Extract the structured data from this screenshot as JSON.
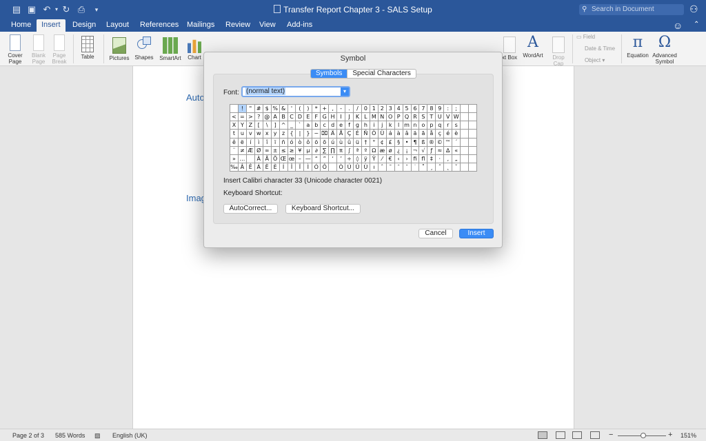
{
  "titlebar": {
    "document_title": "Transfer Report Chapter 3 - SALS Setup",
    "search_placeholder": "Search in Document",
    "icons": [
      "sidebar-icon",
      "save-icon",
      "undo-icon",
      "redo-icon",
      "print-icon",
      "customize-icon",
      "search-icon",
      "share-icon"
    ]
  },
  "ribbon_tabs": {
    "home": "Home",
    "insert": "Insert",
    "design": "Design",
    "layout": "Layout",
    "references": "References",
    "mailings": "Mailings",
    "review": "Review",
    "view": "View",
    "addins": "Add-ins",
    "active": "Insert"
  },
  "ribbon": {
    "cover_page": "Cover",
    "cover_page2": "Page",
    "blank_page": "Blank",
    "blank_page2": "Page",
    "page_break": "Page",
    "page_break2": "Break",
    "table": "Table",
    "pictures": "Pictures",
    "shapes": "Shapes",
    "smartart": "SmartArt",
    "chart": "Chart",
    "text_box": "xt Box",
    "wordart": "WordArt",
    "drop_cap": "Drop",
    "drop_cap2": "Cap",
    "field": "Field",
    "date_time": "Date & Time",
    "object": "Object",
    "equation": "Equation",
    "advanced_symbol": "Advanced",
    "advanced_symbol2": "Symbol",
    "equation_glyph": "π",
    "symbol_glyph": "Ω",
    "wordart_glyph": "A"
  },
  "document": {
    "heading_1": "Auto",
    "heading_2": "Imag"
  },
  "statusbar": {
    "page": "Page 2 of 3",
    "words": "585 Words",
    "language": "English (UK)",
    "zoom": "151%",
    "zoom_out": "−",
    "zoom_in": "+"
  },
  "dialog": {
    "title": "Symbol",
    "tabs": [
      "Symbols",
      "Special Characters"
    ],
    "active_tab": "Symbols",
    "font_label": "Font:",
    "font_value": "(normal text)",
    "selected_symbol": "!",
    "char_info": "Insert Calibri character 33  (Unicode character 0021)",
    "keyboard_shortcut_label": "Keyboard Shortcut:",
    "autocorrect_button": "AutoCorrect...",
    "keyboard_shortcut_button": "Keyboard Shortcut...",
    "cancel_button": "Cancel",
    "insert_button": "Insert",
    "symbol_rows": [
      [
        " ",
        "!",
        "\"",
        "#",
        "$",
        "%",
        "&",
        "'",
        "(",
        ")",
        "*",
        "+",
        ",",
        "-",
        ".",
        "/",
        "0",
        "1",
        "2",
        "3",
        "4",
        "5",
        "6",
        "7",
        "8",
        "9",
        ":",
        ";"
      ],
      [
        "<",
        "=",
        ">",
        "?",
        "@",
        "A",
        "B",
        "C",
        "D",
        "E",
        "F",
        "G",
        "H",
        "I",
        "J",
        "K",
        "L",
        "M",
        "N",
        "O",
        "P",
        "Q",
        "R",
        "S",
        "T",
        "U",
        "V",
        "W"
      ],
      [
        "X",
        "Y",
        "Z",
        "[",
        "\\",
        "]",
        "^",
        "_",
        "`",
        "a",
        "b",
        "c",
        "d",
        "e",
        "f",
        "g",
        "h",
        "i",
        "j",
        "k",
        "l",
        "m",
        "n",
        "o",
        "p",
        "q",
        "r",
        "s"
      ],
      [
        "t",
        "u",
        "v",
        "w",
        "x",
        "y",
        "z",
        "{",
        "|",
        "}",
        "~",
        "⌧",
        "Ä",
        "Å",
        "Ç",
        "É",
        "Ñ",
        "Ö",
        "Ü",
        "á",
        "à",
        "â",
        "ä",
        "ã",
        "å",
        "ç",
        "é",
        "è"
      ],
      [
        "ê",
        "ë",
        "í",
        "ì",
        "î",
        "ï",
        "ñ",
        "ó",
        "ò",
        "ô",
        "ö",
        "õ",
        "ú",
        "ù",
        "û",
        "ü",
        "†",
        "°",
        "¢",
        "£",
        "§",
        "•",
        "¶",
        "ß",
        "®",
        "©",
        "™",
        "´"
      ],
      [
        "¨",
        "≠",
        "Æ",
        "Ø",
        "∞",
        "±",
        "≤",
        "≥",
        "¥",
        "µ",
        "∂",
        "∑",
        "∏",
        "π",
        "∫",
        "ª",
        "º",
        "Ω",
        "æ",
        "ø",
        "¿",
        "¡",
        "¬",
        "√",
        "ƒ",
        "≈",
        "∆",
        "«"
      ],
      [
        "»",
        "…",
        " ",
        "À",
        "Ã",
        "Õ",
        "Œ",
        "œ",
        "–",
        "—",
        "“",
        "”",
        "‘",
        "’",
        "÷",
        "◊",
        "ÿ",
        "Ÿ",
        "⁄",
        "€",
        "‹",
        "›",
        "ﬁ",
        "ﬂ",
        "‡",
        "·",
        "‚",
        "„"
      ],
      [
        "‰",
        "Â",
        "Ê",
        "Á",
        "Ë",
        "È",
        "Í",
        "Î",
        "Ï",
        "Ì",
        "Ó",
        "Ô",
        "",
        "Ò",
        "Ú",
        "Û",
        "Ù",
        "ı",
        "ˆ",
        "˜",
        "¯",
        "˘",
        "˙",
        "˚",
        "¸",
        "˝",
        "˛",
        "ˇ"
      ]
    ]
  },
  "colors": {
    "brand_blue": "#2b579a",
    "accent_blue": "#3b8cf5",
    "heading_blue": "#2e6bb3"
  }
}
